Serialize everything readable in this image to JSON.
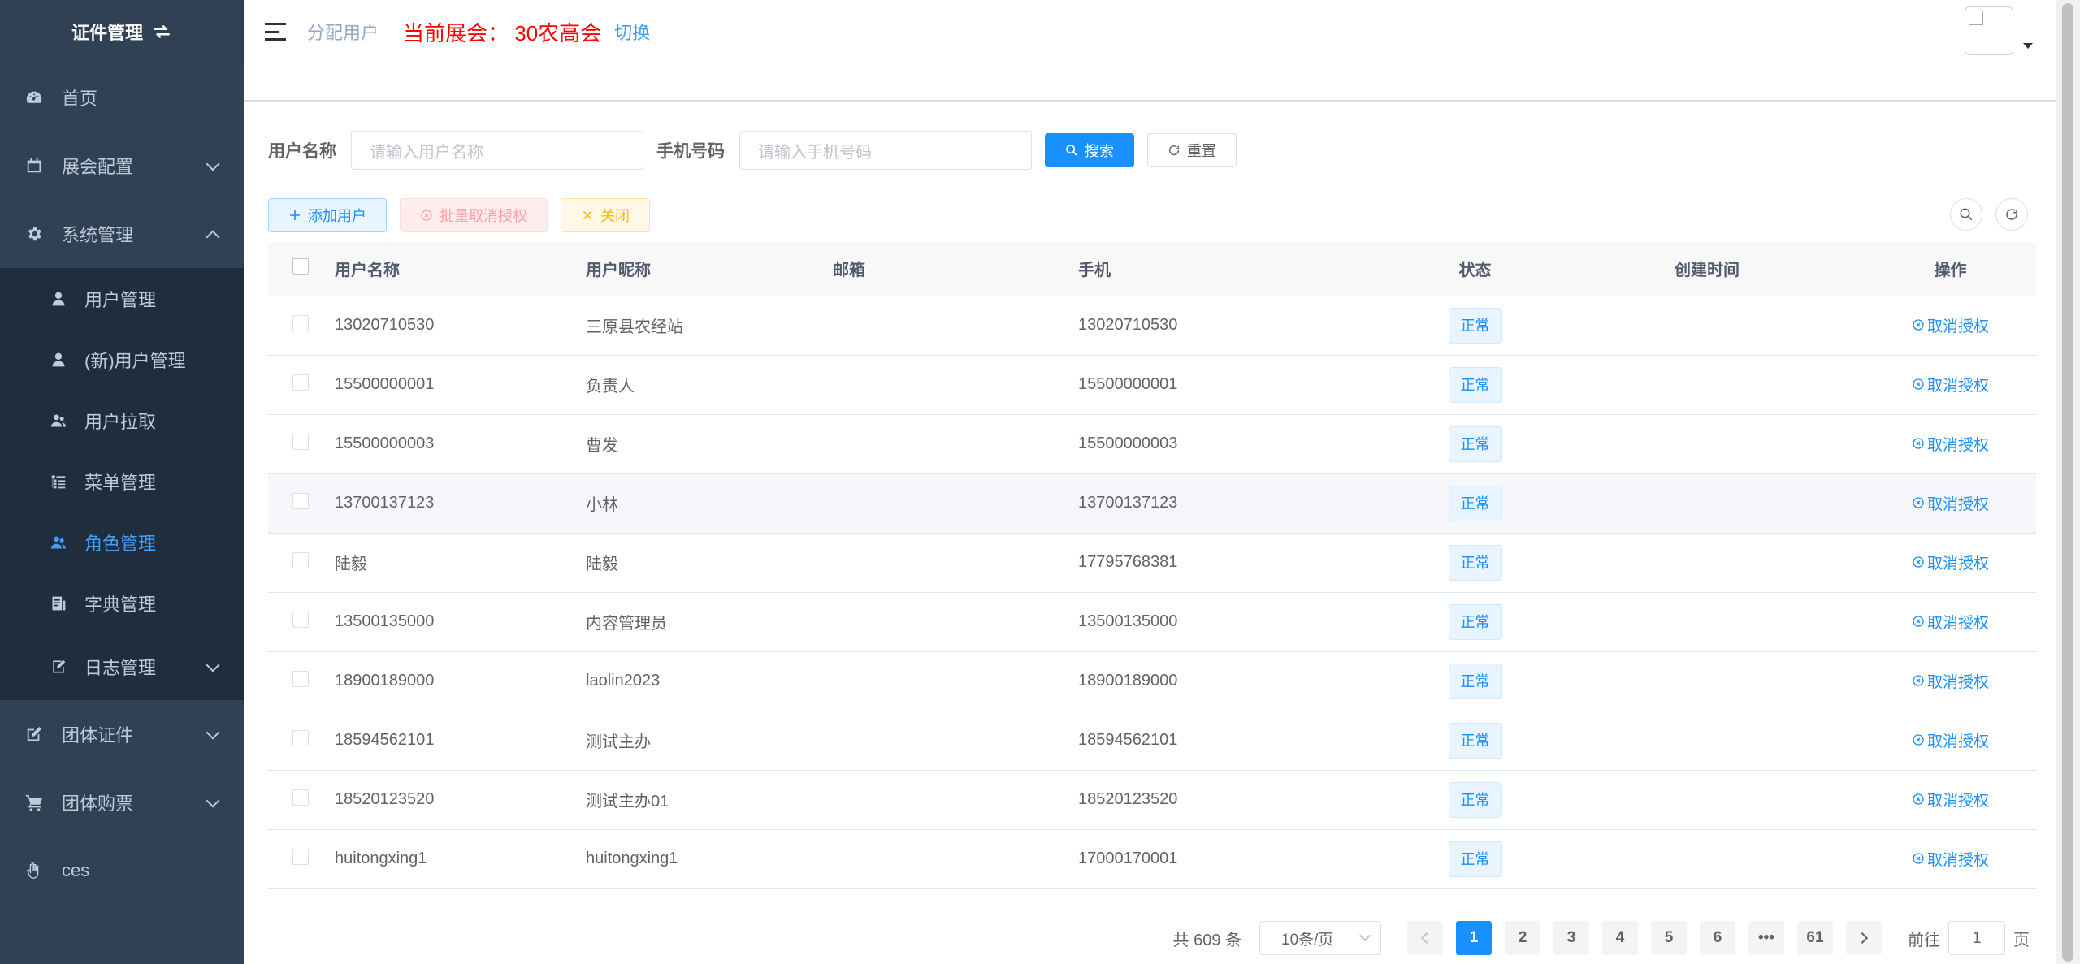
{
  "sidebar": {
    "title": "证件管理",
    "items": [
      {
        "label": "首页",
        "icon": "dashboard-icon"
      },
      {
        "label": "展会配置",
        "icon": "calendar-icon"
      },
      {
        "label": "系统管理",
        "icon": "gear-icon"
      },
      {
        "label": "团体证件",
        "icon": "edit-icon"
      },
      {
        "label": "团体购票",
        "icon": "cart-icon"
      },
      {
        "label": "ces",
        "icon": "hand-icon"
      }
    ],
    "system_sub": [
      {
        "label": "用户管理",
        "icon": "user-icon"
      },
      {
        "label": "(新)用户管理",
        "icon": "user-icon"
      },
      {
        "label": "用户拉取",
        "icon": "peoples-icon"
      },
      {
        "label": "菜单管理",
        "icon": "tree-table-icon"
      },
      {
        "label": "角色管理",
        "icon": "peoples-icon"
      },
      {
        "label": "字典管理",
        "icon": "dict-icon"
      },
      {
        "label": "日志管理",
        "icon": "log-icon"
      }
    ],
    "active_sub": "角色管理"
  },
  "navbar": {
    "breadcrumb": "分配用户",
    "current_expo": "当前展会：  30农高会",
    "switch": "切换"
  },
  "search": {
    "username_label": "用户名称",
    "username_placeholder": "请输入用户名称",
    "phone_label": "手机号码",
    "phone_placeholder": "请输入手机号码",
    "search_btn": "搜索",
    "reset_btn": "重置"
  },
  "toolbar": {
    "add": "添加用户",
    "batch_revoke": "批量取消授权",
    "close": "关闭"
  },
  "table": {
    "headers": {
      "name": "用户名称",
      "nick": "用户昵称",
      "email": "邮箱",
      "phone": "手机",
      "status": "状态",
      "created": "创建时间",
      "op": "操作"
    },
    "op_label": "取消授权",
    "rows": [
      {
        "name": "13020710530",
        "nick": "三原县农经站",
        "email": "",
        "phone": "13020710530",
        "status": "正常",
        "created": ""
      },
      {
        "name": "15500000001",
        "nick": "负责人",
        "email": "",
        "phone": "15500000001",
        "status": "正常",
        "created": ""
      },
      {
        "name": "15500000003",
        "nick": "曹发",
        "email": "",
        "phone": "15500000003",
        "status": "正常",
        "created": ""
      },
      {
        "name": "13700137123",
        "nick": "小林",
        "email": "",
        "phone": "13700137123",
        "status": "正常",
        "created": ""
      },
      {
        "name": "陆毅",
        "nick": "陆毅",
        "email": "",
        "phone": "17795768381",
        "status": "正常",
        "created": ""
      },
      {
        "name": "13500135000",
        "nick": "内容管理员",
        "email": "",
        "phone": "13500135000",
        "status": "正常",
        "created": ""
      },
      {
        "name": "18900189000",
        "nick": "laolin2023",
        "email": "",
        "phone": "18900189000",
        "status": "正常",
        "created": ""
      },
      {
        "name": "18594562101",
        "nick": "测试主办",
        "email": "",
        "phone": "18594562101",
        "status": "正常",
        "created": ""
      },
      {
        "name": "18520123520",
        "nick": "测试主办01",
        "email": "",
        "phone": "18520123520",
        "status": "正常",
        "created": ""
      },
      {
        "name": "huitongxing1",
        "nick": "huitongxing1",
        "email": "",
        "phone": "17000170001",
        "status": "正常",
        "created": ""
      }
    ]
  },
  "pagination": {
    "total": "共 609 条",
    "page_size": "10条/页",
    "pages": [
      "1",
      "2",
      "3",
      "4",
      "5",
      "6",
      "•••",
      "61"
    ],
    "current": "1",
    "goto_label": "前往",
    "goto_value": "1",
    "goto_suffix": "页"
  },
  "colors": {
    "sidebar_bg": "#304156",
    "submenu_bg": "#1f2d3d",
    "primary": "#1890ff",
    "expo_red": "#ff0000"
  }
}
